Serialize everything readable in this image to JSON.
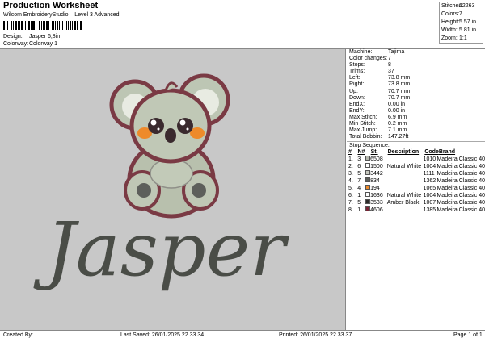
{
  "header": {
    "title": "Production Worksheet",
    "subtitle": "Wilcom EmbroideryStudio – Level 3 Advanced",
    "design_label": "Design:",
    "design_value": "Jasper 6,8in",
    "colorway_label": "Colorway:",
    "colorway_value": "Colorway 1"
  },
  "stats": [
    {
      "label": "Stitches:",
      "value": "22263"
    },
    {
      "label": "Colors:",
      "value": "7"
    },
    {
      "label": "Height:",
      "value": "5.57 in"
    },
    {
      "label": "Width:",
      "value": "5.81 in"
    },
    {
      "label": "Zoom:",
      "value": "1:1"
    }
  ],
  "params": [
    {
      "label": "Machine:",
      "value": "Tajima"
    },
    {
      "label": "Color changes:",
      "value": "7"
    },
    {
      "label": "Stops:",
      "value": "8"
    },
    {
      "label": "Trims:",
      "value": "37"
    },
    {
      "label": "Left:",
      "value": "73.8 mm"
    },
    {
      "label": "Right:",
      "value": "73.8 mm"
    },
    {
      "label": "Up:",
      "value": "70.7 mm"
    },
    {
      "label": "Down:",
      "value": "70.7 mm"
    },
    {
      "label": "EndX:",
      "value": "0.00 in"
    },
    {
      "label": "EndY:",
      "value": "0.00 in"
    },
    {
      "label": "Max Stitch:",
      "value": "6.9 mm"
    },
    {
      "label": "Min Stitch:",
      "value": "0.2 mm"
    },
    {
      "label": "Max Jump:",
      "value": "7.1 mm"
    },
    {
      "label": "Total Bobbin:",
      "value": "147.27ft"
    }
  ],
  "sequence": {
    "title": "Stop Sequence:",
    "headers": {
      "num": "#",
      "stop": "N#",
      "st": "St.",
      "desc": "Description",
      "code": "Code",
      "brand": "Brand"
    },
    "rows": [
      {
        "num": "1.",
        "stop": "3",
        "color": "#b5b7ad",
        "st": "6508",
        "desc": "",
        "code": "1010",
        "brand": "Madeira Classic 40"
      },
      {
        "num": "2.",
        "stop": "6",
        "color": "#ffffff",
        "st": "1500",
        "desc": "Natural White",
        "code": "1004",
        "brand": "Madeira Classic 40"
      },
      {
        "num": "3.",
        "stop": "5",
        "color": "#c7c9c0",
        "st": "3442",
        "desc": "",
        "code": "1111",
        "brand": "Madeira Classic 40"
      },
      {
        "num": "4.",
        "stop": "7",
        "color": "#5d5f5b",
        "st": "834",
        "desc": "",
        "code": "1362",
        "brand": "Madeira Classic 40"
      },
      {
        "num": "5.",
        "stop": "4",
        "color": "#ee8a2a",
        "st": "194",
        "desc": "",
        "code": "1065",
        "brand": "Madeira Classic 40"
      },
      {
        "num": "6.",
        "stop": "1",
        "color": "#ffffff",
        "st": "1636",
        "desc": "Natural White",
        "code": "1004",
        "brand": "Madeira Classic 40"
      },
      {
        "num": "7.",
        "stop": "5",
        "color": "#2c2c2a",
        "st": "3533",
        "desc": "Amber Black",
        "code": "1007",
        "brand": "Madeira Classic 40"
      },
      {
        "num": "8.",
        "stop": "1",
        "color": "#7a2436",
        "st": "4606",
        "desc": "",
        "code": "1385",
        "brand": "Madeira Classic 40"
      }
    ]
  },
  "design": {
    "text": "Jasper"
  },
  "footer": {
    "created_by": "Created By:",
    "last_saved": "Last Saved: 26/01/2025 22.33.34",
    "printed": "Printed: 26/01/2025 22.33.37",
    "page": "Page 1 of 1"
  }
}
